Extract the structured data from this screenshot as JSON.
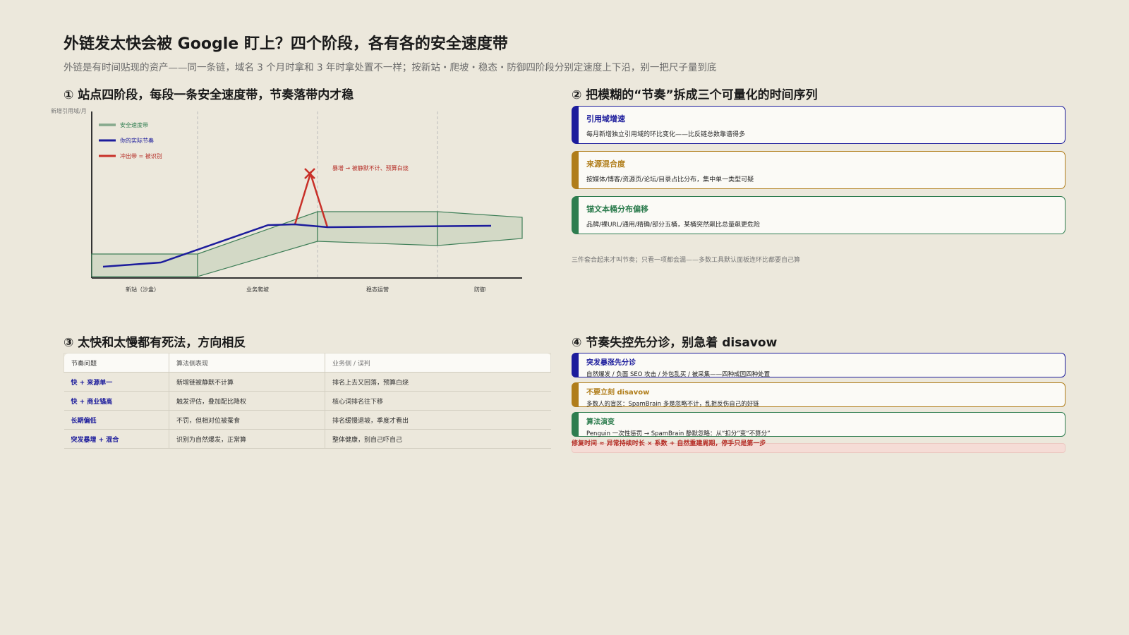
{
  "header": {
    "title": "外链发太快会被 Google 盯上？四个阶段，各有各的安全速度带",
    "subtitle": "外链是有时间贴现的资产——同一条链，域名 3 个月时拿和 3 年时拿处置不一样；按新站・爬坡・稳态・防御四阶段分别定速度上下沿，别一把尺子量到底"
  },
  "section1": {
    "title": "① 站点四阶段，每段一条安全速度带，节奏落带内才稳"
  },
  "section2": {
    "title": "② 把模糊的“节奏”拆成三个可量化的时间序列"
  },
  "section3": {
    "title": "③ 太快和太慢都有死法，方向相反"
  },
  "section4": {
    "title": "④ 节奏失控先分诊，别急着 disavow"
  },
  "chart_data": {
    "type": "line",
    "ylabel": "新增引用域/月",
    "categories": [
      "新站（沙盒）",
      "业务爬坡",
      "稳态运营",
      "防御"
    ],
    "legend": [
      "安全速度带",
      "你的实际节奏",
      "冲出带 = 被识别"
    ],
    "legend_position": "top-left",
    "annotation": "暴增 → 被静默不计、预算白烧",
    "grid": false
  },
  "metrics": [
    {
      "title": "引用域增速",
      "desc": "每月新增独立引用域的环比变化——比反链总数靠谱得多",
      "color": "#1c1c9c"
    },
    {
      "title": "来源混合度",
      "desc": "按媒体/博客/资源页/论坛/目录占比分布，集中单一类型可疑",
      "color": "#b07d1a"
    },
    {
      "title": "锚文本桶分布偏移",
      "desc": "品牌/裸URL/通用/精确/部分五桶，某桶突然飙比总量飙更危险",
      "color": "#2e7d4f"
    }
  ],
  "metrics_footnote": "三件套合起来才叫节奏；只看一项都会漏——多数工具默认面板连环比都要自己算",
  "table": {
    "headers": [
      "节奏问题",
      "算法侧表现",
      "业务侧 / 误判"
    ],
    "rows": [
      [
        "快 + 来源单一",
        "新增链被静默不计算",
        "排名上去又回落，预算白烧"
      ],
      [
        "快 + 商业锚高",
        "触发评估，叠加配比降权",
        "核心词排名往下移"
      ],
      [
        "长期偏低",
        "不罚，但相对位被蚕食",
        "排名缓慢退坡，季度才看出"
      ],
      [
        "突发暴增 + 混合",
        "识别为自然爆发，正常算",
        "整体健康，别自己吓自己"
      ]
    ]
  },
  "diagnosis": [
    {
      "title": "突发暴涨先分诊",
      "desc": "自然爆发 / 负面 SEO 攻击 / 外包乱买 / 被采集——四种成因四种处置",
      "color": "#1c1c9c"
    },
    {
      "title": "不要立刻 disavow",
      "desc": "多数人的盲区：SpamBrain 多是忽略不计，乱拒反伤自己的好链",
      "color": "#b07d1a"
    },
    {
      "title": "算法演变",
      "desc": "Penguin 一次性惩罚 → SpamBrain 静默忽略：从“扣分”变“不算分”",
      "color": "#2e7d4f"
    }
  ],
  "formula": "修复时间 ≈ 异常持续时长 × 系数 + 自然重建周期，停手只是第一步"
}
